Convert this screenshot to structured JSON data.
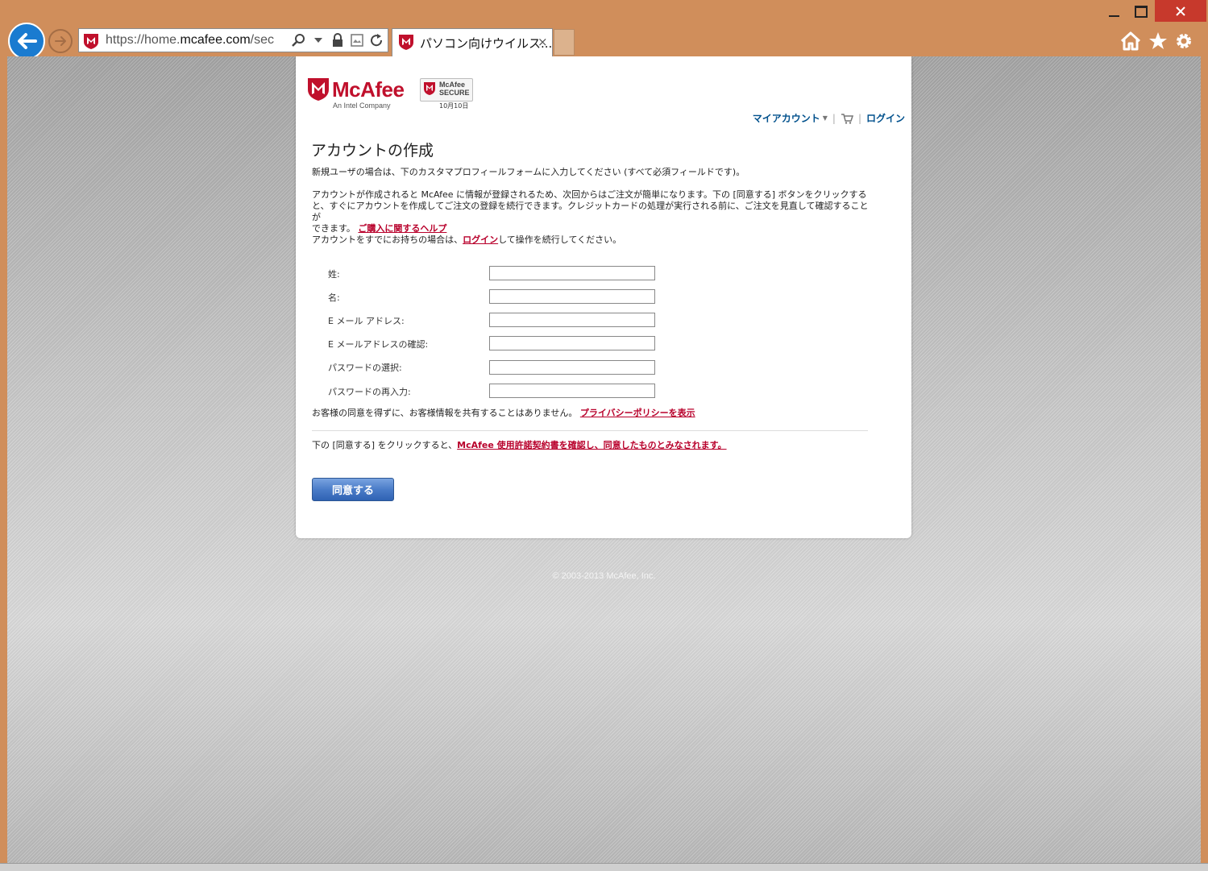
{
  "browser": {
    "url_prefix": "https://home.",
    "url_domain": "mcafee.com",
    "url_suffix": "/sec",
    "tab_title": "パソコン向けウイルス...",
    "tab_close": "×"
  },
  "site": {
    "logo_text": "McAfee",
    "logo_tagline": "An Intel Company",
    "secure_badge_line1": "McAfee",
    "secure_badge_line2": "SECURE",
    "secure_badge_date": "10月10日"
  },
  "topnav": {
    "my_account": "マイアカウント",
    "login": "ログイン"
  },
  "page": {
    "title": "アカウントの作成",
    "intro": "新規ユーザの場合は、下のカスタマプロフィールフォームに入力してください (すべて必須フィールドです)。",
    "desc_line1": "アカウントが作成されると McAfee に情報が登録されるため、次回からはご注文が簡単になります。下の [同意する] ボタンをクリックする",
    "desc_line2": "と、すぐにアカウントを作成してご注文の登録を続行できます。クレジットカードの処理が実行される前に、ご注文を見直して確認することが",
    "desc_line3": "できます。",
    "purchase_help_link": "ご購入に関するヘルプ",
    "existing_prefix": "アカウントをすでにお持ちの場合は、",
    "existing_login_link": "ログイン",
    "existing_suffix": "して操作を続行してください。"
  },
  "form": {
    "fields": [
      {
        "label": "姓:",
        "value": ""
      },
      {
        "label": "名:",
        "value": ""
      },
      {
        "label": "E メール アドレス:",
        "value": ""
      },
      {
        "label": "E メールアドレスの確認:",
        "value": ""
      },
      {
        "label": "パスワードの選択:",
        "value": ""
      },
      {
        "label": "パスワードの再入力:",
        "value": ""
      }
    ]
  },
  "privacy": {
    "text": "お客様の同意を得ずに、お客様情報を共有することはありません。",
    "link": "プライバシーポリシーを表示"
  },
  "agreement": {
    "prefix": "下の [同意する] をクリックすると、",
    "link": "McAfee 使用許諾契約書を確認し、同意したものとみなされます。",
    "button": "同意する"
  },
  "footer": {
    "copyright": "© 2003-2013 McAfee, Inc."
  },
  "colors": {
    "window_frame": "#d08e5b",
    "back_button": "#1a7bd0",
    "close_button": "#c7392c",
    "brand_red": "#c0102c",
    "link_red": "#b8002b",
    "nav_blue": "#00508c",
    "button_blue": "#4a7cc8"
  }
}
